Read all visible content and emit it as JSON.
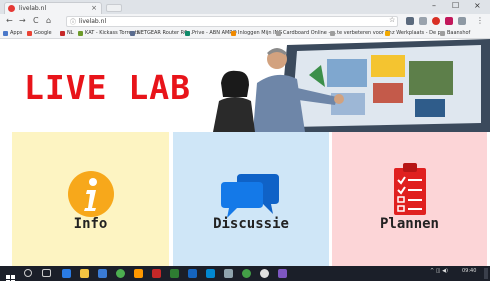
{
  "browser": {
    "tab_title": "livelab.nl",
    "tab_close": "×",
    "window_controls": [
      "–",
      "☐",
      "×"
    ],
    "address": "livelab.nl",
    "bookmarks": [
      {
        "label": "Apps",
        "color": "#4a78c9"
      },
      {
        "label": "Google",
        "color": "#ea4335"
      },
      {
        "label": "NL",
        "color": "#c62828"
      },
      {
        "label": "KAT - Kickass Torrents",
        "color": "#6d9a2a"
      },
      {
        "label": "NETGEAR Router R6...",
        "color": "#5a6c8f"
      },
      {
        "label": "Prive - ABN AMRO",
        "color": "#0f8a6a"
      },
      {
        "label": "Inloggen Mijn ING",
        "color": "#f08a00"
      },
      {
        "label": "Cardboard Online - ...",
        "color": "#9e9e9e"
      },
      {
        "label": "te verbeteren voor Th",
        "color": "#9e9e9e"
      },
      {
        "label": "z Werkplaats - De p...",
        "color": "#f2a900"
      },
      {
        "label": "Baanshof",
        "color": "#9e9e9e"
      }
    ]
  },
  "page": {
    "logo": "LIVE LAB",
    "tiles": [
      {
        "label": "Info",
        "icon": "info-icon",
        "bg": "#fdf4c2",
        "accent": "#f7a81b"
      },
      {
        "label": "Discussie",
        "icon": "chat-bubbles-icon",
        "bg": "#cfe6f7",
        "accent": "#1479e8"
      },
      {
        "label": "Plannen",
        "icon": "clipboard-checklist-icon",
        "bg": "#fcd5d7",
        "accent": "#e0201f"
      }
    ]
  },
  "taskbar": {
    "time": "09:40"
  }
}
